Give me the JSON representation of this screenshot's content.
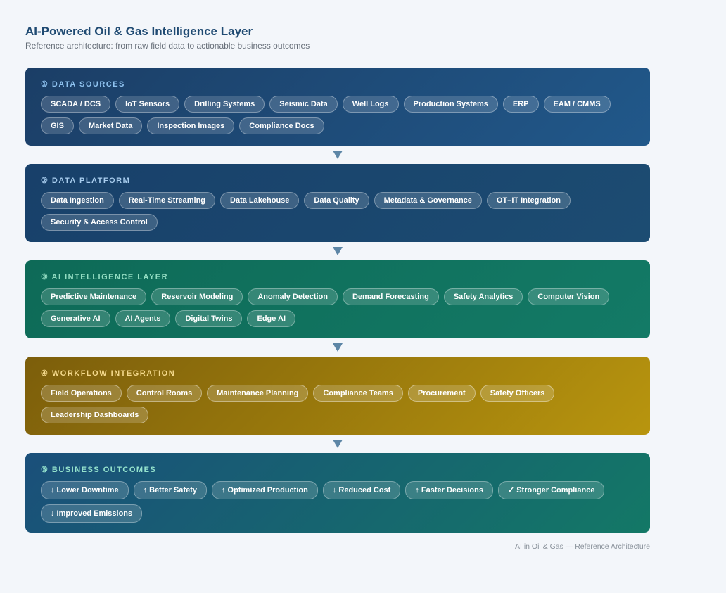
{
  "header": {
    "title": "AI-Powered Oil & Gas Intelligence Layer",
    "subtitle": "Reference architecture: from raw field data to actionable business outcomes"
  },
  "layers": [
    {
      "title": "① DATA SOURCES",
      "items": [
        "SCADA / DCS",
        "IoT Sensors",
        "Drilling Systems",
        "Seismic Data",
        "Well Logs",
        "Production Systems",
        "ERP",
        "EAM / CMMS",
        "GIS",
        "Market Data",
        "Inspection Images",
        "Compliance Docs"
      ]
    },
    {
      "title": "② DATA PLATFORM",
      "items": [
        "Data Ingestion",
        "Real-Time Streaming",
        "Data Lakehouse",
        "Data Quality",
        "Metadata & Governance",
        "OT–IT Integration",
        "Security & Access Control"
      ]
    },
    {
      "title": "③ AI INTELLIGENCE LAYER",
      "items": [
        "Predictive Maintenance",
        "Reservoir Modeling",
        "Anomaly Detection",
        "Demand Forecasting",
        "Safety Analytics",
        "Computer Vision",
        "Generative AI",
        "AI Agents",
        "Digital Twins",
        "Edge AI"
      ]
    },
    {
      "title": "④ WORKFLOW INTEGRATION",
      "items": [
        "Field Operations",
        "Control Rooms",
        "Maintenance Planning",
        "Compliance Teams",
        "Procurement",
        "Safety Officers",
        "Leadership Dashboards"
      ]
    },
    {
      "title": "⑤ BUSINESS OUTCOMES",
      "items": [
        "↓ Lower Downtime",
        "↑ Better Safety",
        "↑ Optimized Production",
        "↓ Reduced Cost",
        "↑ Faster Decisions",
        "✓ Stronger Compliance",
        "↓ Improved Emissions"
      ]
    }
  ],
  "footer": "AI in Oil & Gas — Reference Architecture",
  "colors": {
    "data_sources": "#1b3e66",
    "data_platform": "#18406a",
    "ai_layer": "#0e6a57",
    "workflow": "#9a760c",
    "outcomes": "#156476",
    "arrow": "#5d86a6",
    "title": "#1f4a72"
  },
  "icons": {
    "connector": "down-triangle-arrow-icon"
  }
}
